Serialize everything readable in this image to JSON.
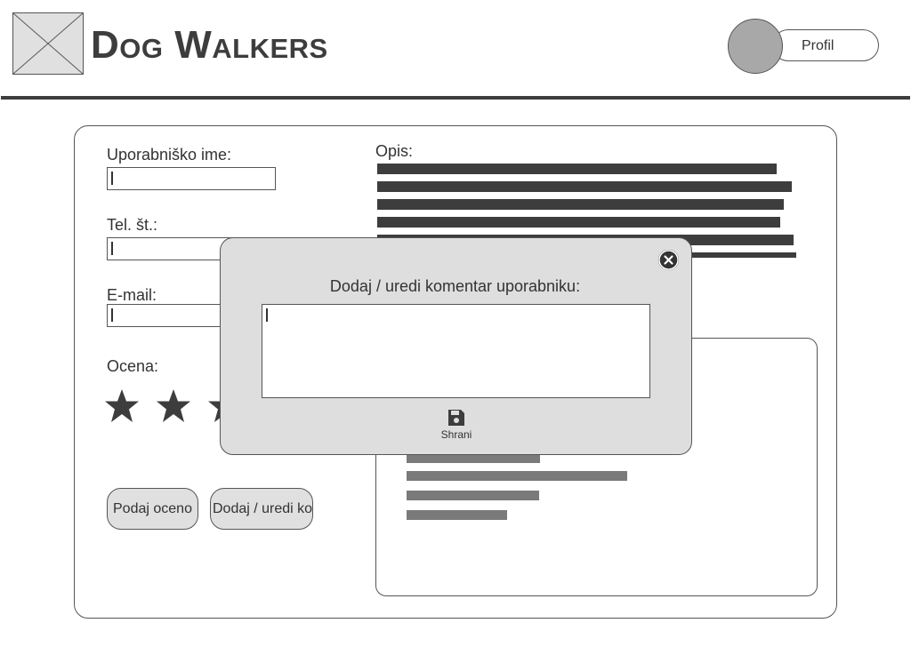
{
  "header": {
    "title": "Dog Walkers",
    "profile_label": "Profil",
    "logo_icon": "image-placeholder-icon",
    "avatar_icon": "avatar-circle"
  },
  "form": {
    "username_label": "Uporabniško ime:",
    "phone_label": "Tel. št.:",
    "email_label": "E-mail:",
    "rating_label": "Ocena:",
    "rating_stars": 3,
    "rate_button": "Podaj oceno",
    "comment_button": "Dodaj / uredi ko"
  },
  "description": {
    "label": "Opis:"
  },
  "modal": {
    "title": "Dodaj / uredi komentar uporabniku:",
    "textarea_value": "",
    "save_label": "Shrani",
    "close_icon": "close-icon",
    "save_icon": "save-icon"
  },
  "colors": {
    "dark": "#3d3d3d",
    "panel_gray": "#dedede",
    "bar_gray": "#7a7a7a"
  }
}
